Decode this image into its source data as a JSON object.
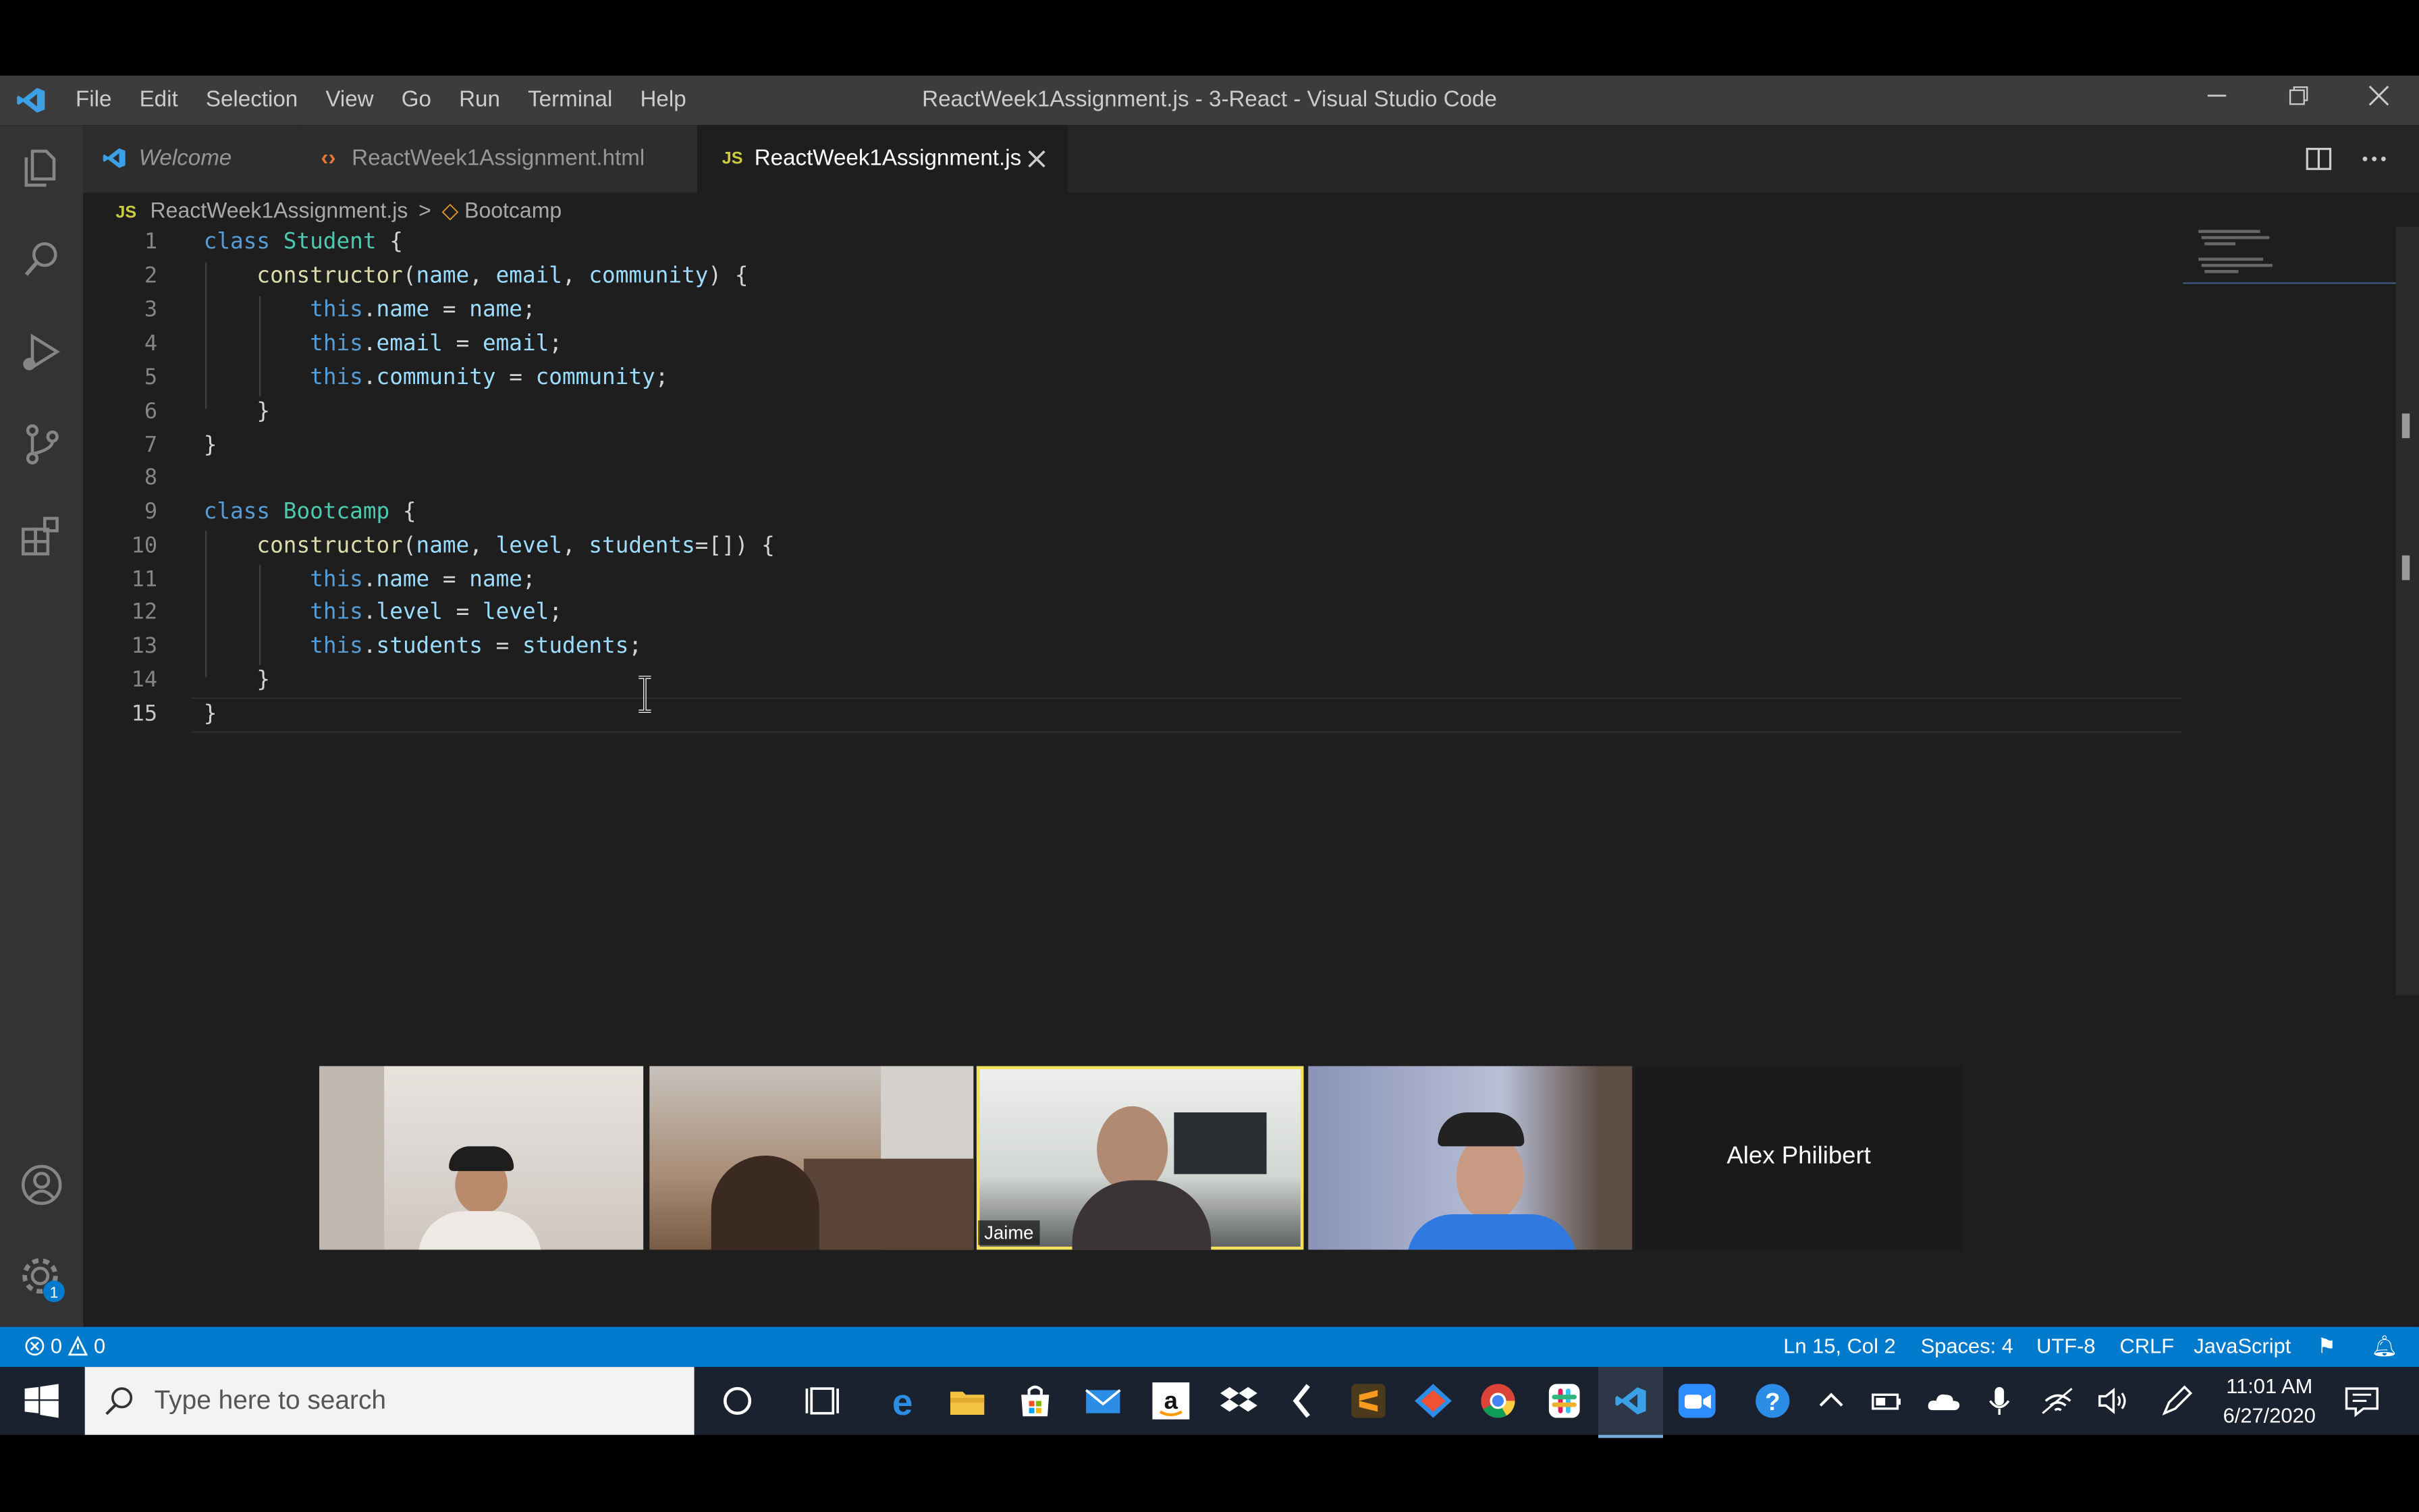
{
  "app": {
    "window_title": "ReactWeek1Assignment.js - 3-React - Visual Studio Code",
    "menu": [
      "File",
      "Edit",
      "Selection",
      "View",
      "Go",
      "Run",
      "Terminal",
      "Help"
    ]
  },
  "tabs": [
    {
      "label": "Welcome",
      "icon": "vscode-logo-icon"
    },
    {
      "label": "ReactWeek1Assignment.html",
      "icon": "html-file-icon"
    },
    {
      "label": "ReactWeek1Assignment.js",
      "icon": "js-file-icon",
      "badge": "JS",
      "active": true
    }
  ],
  "breadcrumb": {
    "file": "ReactWeek1Assignment.js",
    "file_badge": "JS",
    "separator": ">",
    "symbol": "Bootcamp"
  },
  "code_lines": [
    {
      "n": "1",
      "text": "class Student {"
    },
    {
      "n": "2",
      "text": "    constructor(name, email, community) {"
    },
    {
      "n": "3",
      "text": "        this.name = name;"
    },
    {
      "n": "4",
      "text": "        this.email = email;"
    },
    {
      "n": "5",
      "text": "        this.community = community;"
    },
    {
      "n": "6",
      "text": "    }"
    },
    {
      "n": "7",
      "text": "}"
    },
    {
      "n": "8",
      "text": ""
    },
    {
      "n": "9",
      "text": "class Bootcamp {"
    },
    {
      "n": "10",
      "text": "    constructor(name, level, students=[]) {"
    },
    {
      "n": "11",
      "text": "        this.name = name;"
    },
    {
      "n": "12",
      "text": "        this.level = level;"
    },
    {
      "n": "13",
      "text": "        this.students = students;"
    },
    {
      "n": "14",
      "text": "    }"
    },
    {
      "n": "15",
      "text": "}"
    }
  ],
  "video": {
    "participants": [
      {
        "label": ""
      },
      {
        "label": ""
      },
      {
        "label": "Jaime",
        "active": true
      },
      {
        "label": ""
      },
      {
        "label": "Alex Philibert"
      }
    ]
  },
  "status": {
    "errors": "0",
    "warnings": "0",
    "position": "Ln 15, Col 2",
    "spaces": "Spaces: 4",
    "encoding": "UTF-8",
    "eol": "CRLF",
    "language": "JavaScript"
  },
  "taskbar": {
    "search_placeholder": "Type here to search",
    "time": "11:01 AM",
    "date": "6/27/2020"
  },
  "colors": {
    "accent": "#007acc",
    "keyword": "#569cd6",
    "class": "#4ec9b0",
    "function": "#dcdcaa",
    "variable": "#9cdcfe"
  }
}
